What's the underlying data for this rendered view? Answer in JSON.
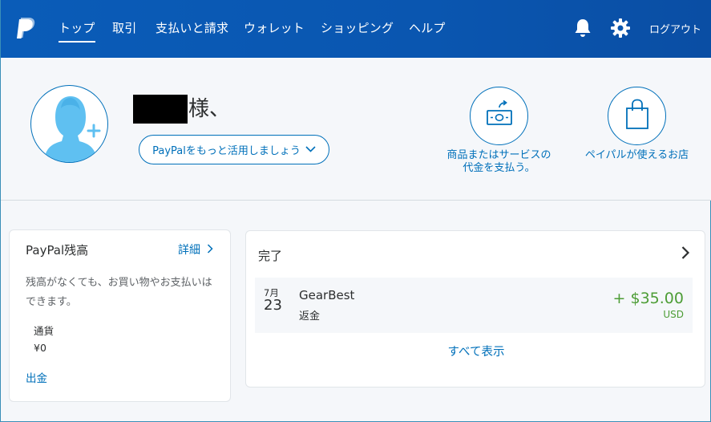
{
  "nav": {
    "logo_icon": "paypal-logo-icon",
    "items": [
      {
        "label": "トップ",
        "active": true
      },
      {
        "label": "取引",
        "active": false
      },
      {
        "label": "支払いと請求",
        "active": false
      },
      {
        "label": "ウォレット",
        "active": false
      },
      {
        "label": "ショッピング",
        "active": false
      },
      {
        "label": "ヘルプ",
        "active": false
      }
    ],
    "notification_icon": "bell-icon",
    "settings_icon": "gear-icon",
    "logout_label": "ログアウト"
  },
  "header": {
    "avatar_icon": "user-avatar-add-icon",
    "greeting_suffix": "様、",
    "promo_button_label": "PayPalをもっと活用しましょう",
    "actions": [
      {
        "icon": "send-money-icon",
        "label_lines": [
          "商品またはサービスの",
          "代金を支払う。"
        ]
      },
      {
        "icon": "shopping-bag-icon",
        "label_lines": [
          "ペイパルが使えるお店"
        ]
      }
    ]
  },
  "balance": {
    "title": "PayPal残高",
    "detail_link": "詳細",
    "description": "残高がなくても、お買い物やお支払いはできます。",
    "currency_label": "通貨",
    "amount": "¥0",
    "withdraw_link": "出金"
  },
  "activity": {
    "title": "完了",
    "transactions": [
      {
        "month": "7月",
        "day": "23",
        "merchant": "GearBest",
        "type": "返金",
        "amount": "+ $35.00",
        "currency": "USD"
      }
    ],
    "show_all_label": "すべて表示"
  },
  "colors": {
    "nav_bg": "#0a5cb8",
    "accent": "#0070ba",
    "positive": "#4d9d36",
    "text": "#2c2e2f"
  }
}
